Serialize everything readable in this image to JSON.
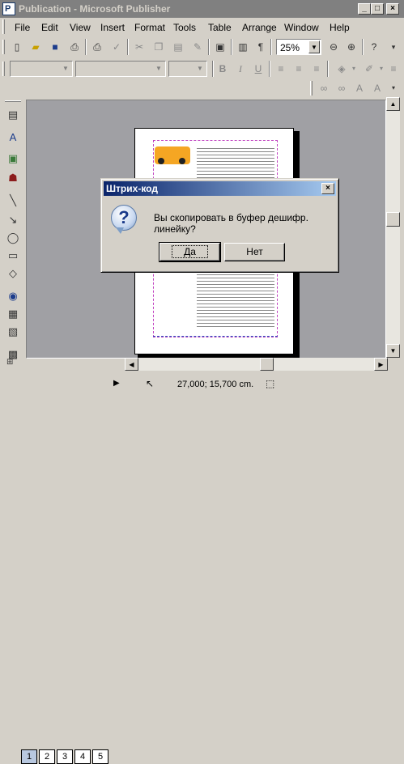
{
  "window": {
    "title": "Publication - Microsoft Publisher",
    "icon_letter": "P",
    "minimize": "_",
    "maximize": "□",
    "close": "×"
  },
  "menu": {
    "items": [
      "File",
      "Edit",
      "View",
      "Insert",
      "Format",
      "Tools",
      "Table",
      "Arrange",
      "Window",
      "Help"
    ]
  },
  "standard_toolbar": {
    "zoom_value": "25%",
    "icons": [
      "new-icon",
      "open-icon",
      "save-icon",
      "print-preview-icon",
      "print-icon",
      "spelling-icon",
      "cut-icon",
      "copy-icon",
      "paste-icon",
      "format-painter-icon",
      "insert-clipart-icon",
      "show-formatting-icon",
      "zoom-out-icon",
      "zoom-in-icon"
    ]
  },
  "formatting_toolbar": {
    "icons": [
      "bold-icon",
      "italic-icon",
      "underline-icon",
      "align-left-icon",
      "align-center-icon",
      "align-right-icon",
      "fill-color-icon",
      "line-color-icon"
    ]
  },
  "dialog": {
    "title": "Штрих-код",
    "message": "Вы скопировать в буфер дешифр. линейку?",
    "yes_label": "Да",
    "no_label": "Нет",
    "icon_glyph": "?"
  },
  "status": {
    "coordinates": "27,000; 15,700 cm.",
    "pages": [
      "1",
      "2",
      "3",
      "4",
      "5"
    ],
    "active_page": "1"
  },
  "colors": {
    "title_inactive": "#808080",
    "dialog_title_start": "#0a246a",
    "dialog_title_end": "#a6caf0",
    "workspace": "#a0a0a4"
  }
}
